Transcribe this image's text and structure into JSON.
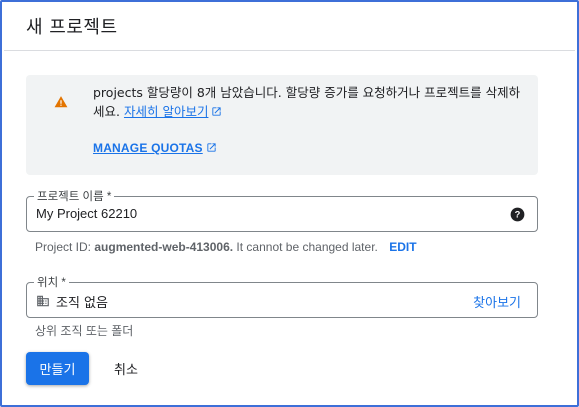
{
  "dialog": {
    "title": "새 프로젝트"
  },
  "quota_warning": {
    "text": "projects 할당량이 8개 남았습니다. 할당량 증가를 요청하거나 프로젝트를 삭제하세요.",
    "learn_more": "자세히 알아보기",
    "manage_quotas": "MANAGE QUOTAS"
  },
  "project_name": {
    "label": "프로젝트 이름 *",
    "value": "My Project 62210"
  },
  "project_id": {
    "prefix": "Project ID:",
    "id": "augmented-web-413006.",
    "suffix": "It cannot be changed later.",
    "edit": "EDIT"
  },
  "location": {
    "label": "위치 *",
    "value": "조직 없음",
    "browse": "찾아보기",
    "hint": "상위 조직 또는 폴더"
  },
  "actions": {
    "create": "만들기",
    "cancel": "취소"
  },
  "colors": {
    "accent": "#1a73e8",
    "warning": "#e37400",
    "frame": "#3d6fd8"
  }
}
